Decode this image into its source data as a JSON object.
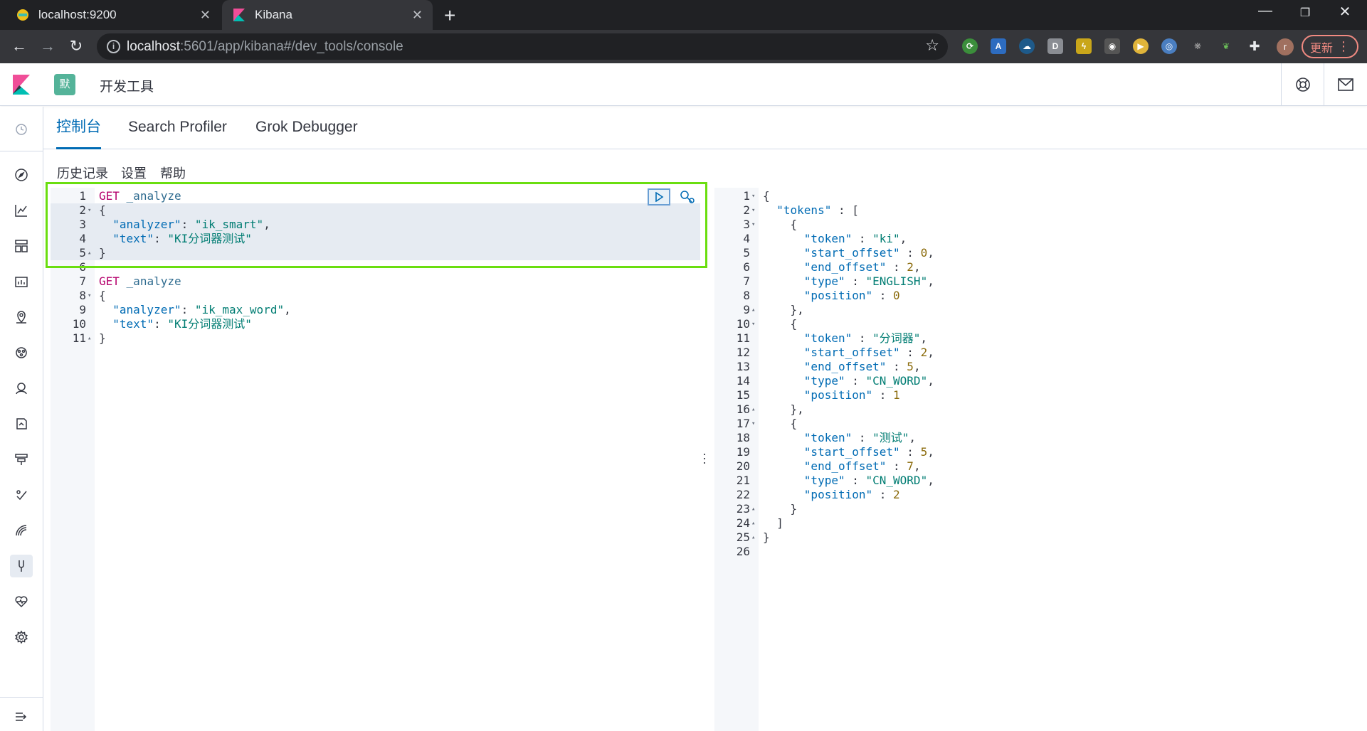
{
  "browser": {
    "tabs": [
      {
        "title": "localhost:9200",
        "active": false
      },
      {
        "title": "Kibana",
        "active": true
      }
    ],
    "url": {
      "host": "localhost",
      "rest": ":5601/app/kibana#/dev_tools/console"
    },
    "update_label": "更新",
    "profile_initial": "r",
    "extensions": [
      "sync-ext-icon",
      "translate-ext-icon",
      "cloud-ext-icon",
      "d-ext-icon",
      "pikachu-ext-icon",
      "owl-ext-icon",
      "play-ext-icon",
      "tamper-ext-icon",
      "paw-ext-icon",
      "leaf-ext-icon",
      "puzzle-icon"
    ]
  },
  "kibana": {
    "space_badge": "默",
    "page_title": "开发工具",
    "tabs": [
      "控制台",
      "Search Profiler",
      "Grok Debugger"
    ],
    "selected_tab": "控制台",
    "menu": [
      "历史记录",
      "设置",
      "帮助"
    ],
    "nav_icons": [
      "clock-icon",
      "discover-icon",
      "visualize-icon",
      "dashboard-icon",
      "canvas-icon",
      "maps-icon",
      "ml-icon",
      "uptime-icon",
      "siem-icon",
      "apm-icon",
      "logs-icon",
      "metrics-icon",
      "devtools-icon",
      "monitoring-icon",
      "management-icon",
      "collapse-icon"
    ]
  },
  "request_editor": {
    "lines": [
      {
        "n": "1",
        "fold": "",
        "tokens": [
          [
            "method",
            "GET"
          ],
          [
            "punc",
            " "
          ],
          [
            "path",
            "_analyze"
          ]
        ]
      },
      {
        "n": "2",
        "fold": "▾",
        "tokens": [
          [
            "punc",
            "{"
          ]
        ]
      },
      {
        "n": "3",
        "fold": "",
        "tokens": [
          [
            "punc",
            "  "
          ],
          [
            "key",
            "\"analyzer\""
          ],
          [
            "punc",
            ": "
          ],
          [
            "str",
            "\"ik_smart\""
          ],
          [
            "punc",
            ","
          ]
        ]
      },
      {
        "n": "4",
        "fold": "",
        "tokens": [
          [
            "punc",
            "  "
          ],
          [
            "key",
            "\"text\""
          ],
          [
            "punc",
            ": "
          ],
          [
            "str",
            "\"KI分词器测试\""
          ]
        ]
      },
      {
        "n": "5",
        "fold": "▴",
        "tokens": [
          [
            "punc",
            "}"
          ]
        ]
      },
      {
        "n": "6",
        "fold": "",
        "tokens": []
      },
      {
        "n": "7",
        "fold": "",
        "tokens": [
          [
            "method",
            "GET"
          ],
          [
            "punc",
            " "
          ],
          [
            "path",
            "_analyze"
          ]
        ]
      },
      {
        "n": "8",
        "fold": "▾",
        "tokens": [
          [
            "punc",
            "{"
          ]
        ]
      },
      {
        "n": "9",
        "fold": "",
        "tokens": [
          [
            "punc",
            "  "
          ],
          [
            "key",
            "\"analyzer\""
          ],
          [
            "punc",
            ": "
          ],
          [
            "str",
            "\"ik_max_word\""
          ],
          [
            "punc",
            ","
          ]
        ]
      },
      {
        "n": "10",
        "fold": "",
        "tokens": [
          [
            "punc",
            "  "
          ],
          [
            "key",
            "\"text\""
          ],
          [
            "punc",
            ": "
          ],
          [
            "str",
            "\"KI分词器测试\""
          ]
        ]
      },
      {
        "n": "11",
        "fold": "▴",
        "tokens": [
          [
            "punc",
            "}"
          ]
        ]
      }
    ]
  },
  "response_editor": {
    "lines": [
      {
        "n": "1",
        "fold": "▾",
        "tokens": [
          [
            "punc",
            "{"
          ]
        ]
      },
      {
        "n": "2",
        "fold": "▾",
        "tokens": [
          [
            "punc",
            "  "
          ],
          [
            "key",
            "\"tokens\""
          ],
          [
            "punc",
            " : ["
          ]
        ]
      },
      {
        "n": "3",
        "fold": "▾",
        "tokens": [
          [
            "punc",
            "    {"
          ]
        ]
      },
      {
        "n": "4",
        "fold": "",
        "tokens": [
          [
            "punc",
            "      "
          ],
          [
            "key",
            "\"token\""
          ],
          [
            "punc",
            " : "
          ],
          [
            "str",
            "\"ki\""
          ],
          [
            "punc",
            ","
          ]
        ]
      },
      {
        "n": "5",
        "fold": "",
        "tokens": [
          [
            "punc",
            "      "
          ],
          [
            "key",
            "\"start_offset\""
          ],
          [
            "punc",
            " : "
          ],
          [
            "num",
            "0"
          ],
          [
            "punc",
            ","
          ]
        ]
      },
      {
        "n": "6",
        "fold": "",
        "tokens": [
          [
            "punc",
            "      "
          ],
          [
            "key",
            "\"end_offset\""
          ],
          [
            "punc",
            " : "
          ],
          [
            "num",
            "2"
          ],
          [
            "punc",
            ","
          ]
        ]
      },
      {
        "n": "7",
        "fold": "",
        "tokens": [
          [
            "punc",
            "      "
          ],
          [
            "key",
            "\"type\""
          ],
          [
            "punc",
            " : "
          ],
          [
            "str",
            "\"ENGLISH\""
          ],
          [
            "punc",
            ","
          ]
        ]
      },
      {
        "n": "8",
        "fold": "",
        "tokens": [
          [
            "punc",
            "      "
          ],
          [
            "key",
            "\"position\""
          ],
          [
            "punc",
            " : "
          ],
          [
            "num",
            "0"
          ]
        ]
      },
      {
        "n": "9",
        "fold": "▴",
        "tokens": [
          [
            "punc",
            "    },"
          ]
        ]
      },
      {
        "n": "10",
        "fold": "▾",
        "tokens": [
          [
            "punc",
            "    {"
          ]
        ]
      },
      {
        "n": "11",
        "fold": "",
        "tokens": [
          [
            "punc",
            "      "
          ],
          [
            "key",
            "\"token\""
          ],
          [
            "punc",
            " : "
          ],
          [
            "str",
            "\"分词器\""
          ],
          [
            "punc",
            ","
          ]
        ]
      },
      {
        "n": "12",
        "fold": "",
        "tokens": [
          [
            "punc",
            "      "
          ],
          [
            "key",
            "\"start_offset\""
          ],
          [
            "punc",
            " : "
          ],
          [
            "num",
            "2"
          ],
          [
            "punc",
            ","
          ]
        ]
      },
      {
        "n": "13",
        "fold": "",
        "tokens": [
          [
            "punc",
            "      "
          ],
          [
            "key",
            "\"end_offset\""
          ],
          [
            "punc",
            " : "
          ],
          [
            "num",
            "5"
          ],
          [
            "punc",
            ","
          ]
        ]
      },
      {
        "n": "14",
        "fold": "",
        "tokens": [
          [
            "punc",
            "      "
          ],
          [
            "key",
            "\"type\""
          ],
          [
            "punc",
            " : "
          ],
          [
            "str",
            "\"CN_WORD\""
          ],
          [
            "punc",
            ","
          ]
        ]
      },
      {
        "n": "15",
        "fold": "",
        "tokens": [
          [
            "punc",
            "      "
          ],
          [
            "key",
            "\"position\""
          ],
          [
            "punc",
            " : "
          ],
          [
            "num",
            "1"
          ]
        ]
      },
      {
        "n": "16",
        "fold": "▴",
        "tokens": [
          [
            "punc",
            "    },"
          ]
        ]
      },
      {
        "n": "17",
        "fold": "▾",
        "tokens": [
          [
            "punc",
            "    {"
          ]
        ]
      },
      {
        "n": "18",
        "fold": "",
        "tokens": [
          [
            "punc",
            "      "
          ],
          [
            "key",
            "\"token\""
          ],
          [
            "punc",
            " : "
          ],
          [
            "str",
            "\"测试\""
          ],
          [
            "punc",
            ","
          ]
        ]
      },
      {
        "n": "19",
        "fold": "",
        "tokens": [
          [
            "punc",
            "      "
          ],
          [
            "key",
            "\"start_offset\""
          ],
          [
            "punc",
            " : "
          ],
          [
            "num",
            "5"
          ],
          [
            "punc",
            ","
          ]
        ]
      },
      {
        "n": "20",
        "fold": "",
        "tokens": [
          [
            "punc",
            "      "
          ],
          [
            "key",
            "\"end_offset\""
          ],
          [
            "punc",
            " : "
          ],
          [
            "num",
            "7"
          ],
          [
            "punc",
            ","
          ]
        ]
      },
      {
        "n": "21",
        "fold": "",
        "tokens": [
          [
            "punc",
            "      "
          ],
          [
            "key",
            "\"type\""
          ],
          [
            "punc",
            " : "
          ],
          [
            "str",
            "\"CN_WORD\""
          ],
          [
            "punc",
            ","
          ]
        ]
      },
      {
        "n": "22",
        "fold": "",
        "tokens": [
          [
            "punc",
            "      "
          ],
          [
            "key",
            "\"position\""
          ],
          [
            "punc",
            " : "
          ],
          [
            "num",
            "2"
          ]
        ]
      },
      {
        "n": "23",
        "fold": "▴",
        "tokens": [
          [
            "punc",
            "    }"
          ]
        ]
      },
      {
        "n": "24",
        "fold": "▴",
        "tokens": [
          [
            "punc",
            "  ]"
          ]
        ]
      },
      {
        "n": "25",
        "fold": "▴",
        "tokens": [
          [
            "punc",
            "}"
          ]
        ]
      },
      {
        "n": "26",
        "fold": "",
        "tokens": []
      }
    ]
  },
  "colors": {
    "accent": "#006bb4",
    "highlight_box": "#6ade0f",
    "space_badge": "#54b399"
  }
}
